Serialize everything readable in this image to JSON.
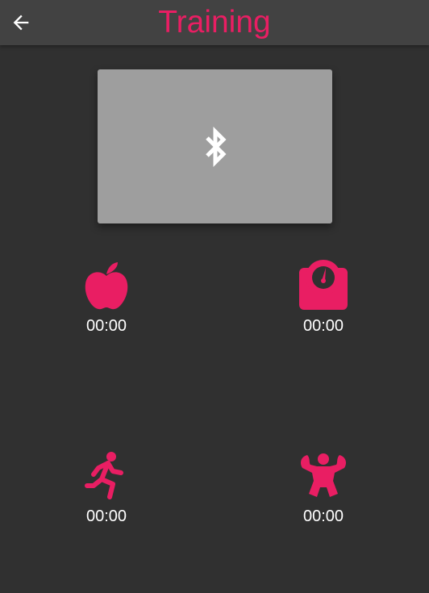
{
  "app_bar": {
    "title": "Training",
    "back_icon": "arrow-back-icon",
    "title_color": "#e91e63",
    "background": "#424242"
  },
  "bluetooth_card": {
    "icon": "bluetooth-icon",
    "background": "#9e9e9e"
  },
  "tiles": [
    {
      "icon": "apple-icon",
      "time": "00:00"
    },
    {
      "icon": "scale-icon",
      "time": "00:00"
    },
    {
      "icon": "running-person-icon",
      "time": "00:00"
    },
    {
      "icon": "muscle-man-icon",
      "time": "00:00"
    }
  ],
  "accent": "#e91e63"
}
